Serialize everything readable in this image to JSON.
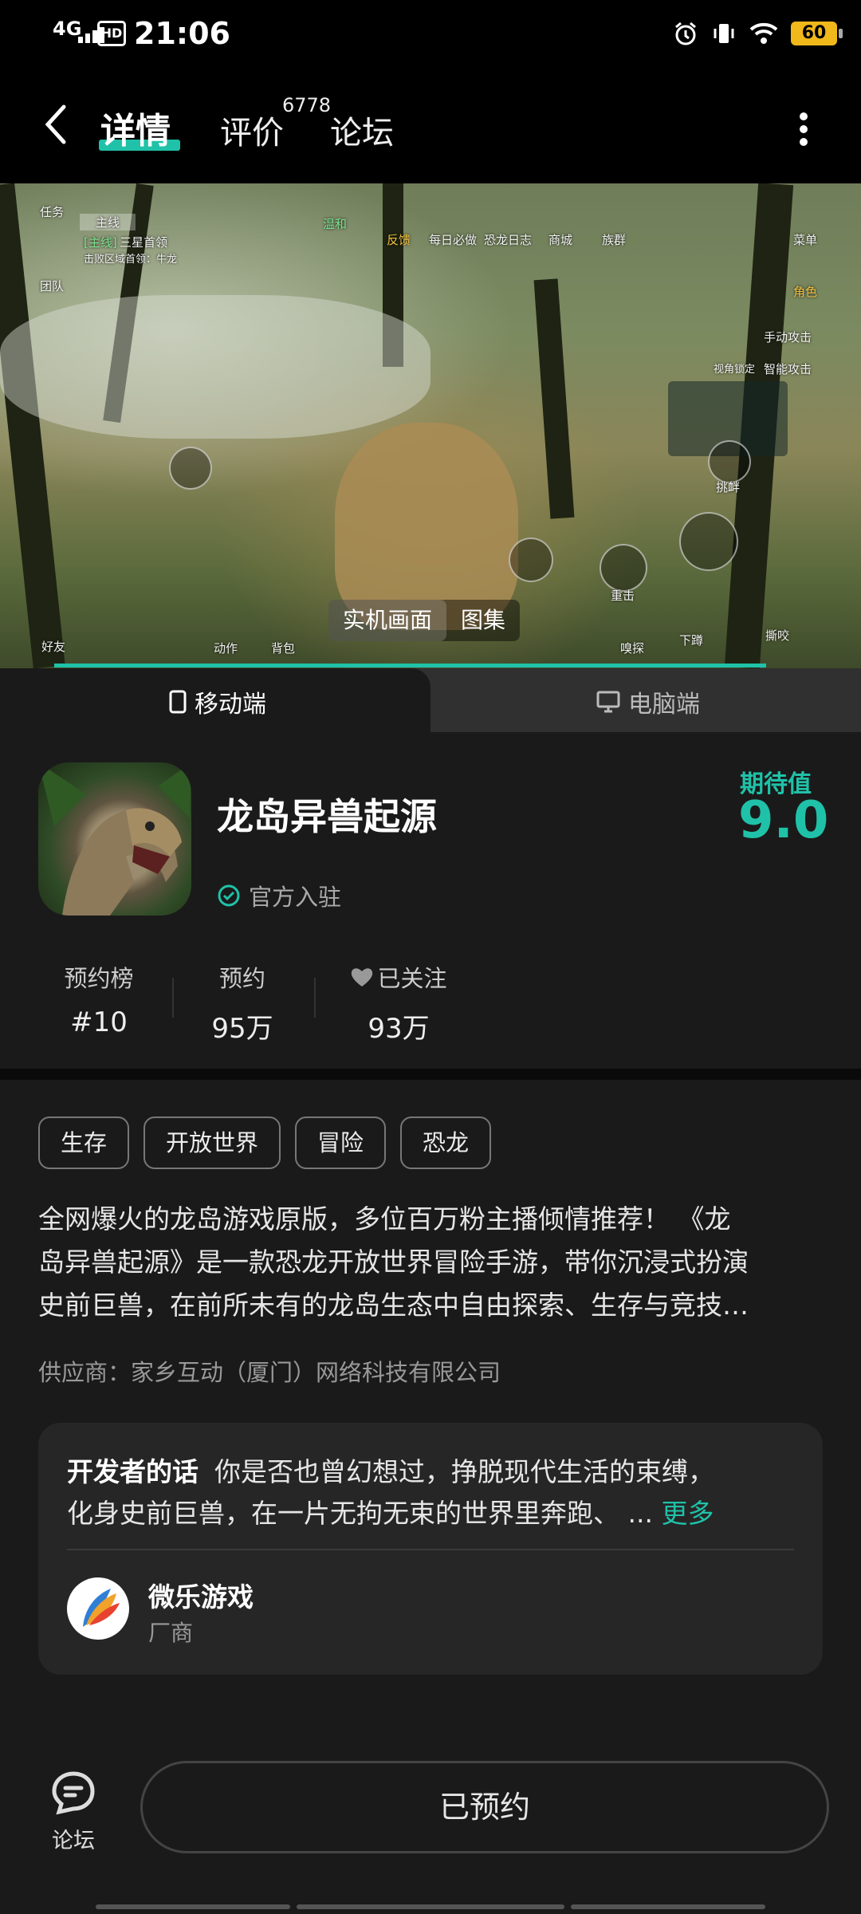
{
  "status_bar": {
    "network": "4G",
    "hd": "HD",
    "time": "21:06",
    "battery": "60"
  },
  "header": {
    "tabs": [
      {
        "label": "详情",
        "active": true
      },
      {
        "label": "评价",
        "count": "6778"
      },
      {
        "label": "论坛"
      }
    ]
  },
  "hero": {
    "hud": {
      "task": "任务",
      "mainline_tab": "主线",
      "mainline_tag": "[主线]",
      "quest": "三星首领",
      "quest_sub": "击败区域首领：牛龙",
      "team": "团队",
      "temperament": "温和",
      "feedback": "反馈",
      "daily": "每日必做",
      "dino_log": "恐龙日志",
      "shop": "商城",
      "tribe": "族群",
      "menu": "菜单",
      "role": "角色",
      "auto_attack": "手动攻击",
      "smart_attack": "智能攻击",
      "lock_view": "视角锁定",
      "challenge": "挑衅",
      "heavy": "重击",
      "friends": "好友",
      "action": "动作",
      "backpack": "背包",
      "sniff": "嗅探",
      "crouch": "下蹲",
      "bite": "撕咬"
    },
    "media_tabs": [
      {
        "label": "实机画面",
        "active": true
      },
      {
        "label": "图集",
        "active": false
      }
    ],
    "progress": 0.89
  },
  "platform_tabs": [
    {
      "label": "移动端",
      "active": true,
      "icon": "phone-icon"
    },
    {
      "label": "电脑端",
      "active": false,
      "icon": "monitor-icon"
    }
  ],
  "game": {
    "title": "龙岛异兽起源",
    "official_label": "官方入驻",
    "expect_label": "期待值",
    "expect_value": "9.0",
    "stats": [
      {
        "label": "预约榜",
        "value": "#10"
      },
      {
        "label": "预约",
        "value": "95万"
      },
      {
        "label": "已关注",
        "value": "93万",
        "icon": "heart-icon"
      }
    ],
    "tags": [
      "生存",
      "开放世界",
      "冒险",
      "恐龙"
    ],
    "description_lines": [
      "全网爆火的龙岛游戏原版，多位百万粉主播倾情推荐！  《龙",
      "岛异兽起源》是一款恐龙开放世界冒险手游，带你沉浸式扮演",
      "史前巨兽，在前所未有的龙岛生态中自由探索、生存与竞技…"
    ],
    "supplier": "供应商：家乡互动（厦门）网络科技有限公司"
  },
  "developer": {
    "heading": "开发者的话",
    "text_line1": "你是否也曾幻想过，挣脱现代生活的束缚，",
    "text_line2": "化身史前巨兽，在一片无拘无束的世界里奔跑、 ...",
    "more": "更多",
    "name": "微乐游戏",
    "role": "厂商"
  },
  "bottom": {
    "forum_label": "论坛",
    "reserve_label": "已预约"
  },
  "colors": {
    "accent": "#1fc2a8",
    "background": "#1a1a1a",
    "card": "#262626"
  }
}
